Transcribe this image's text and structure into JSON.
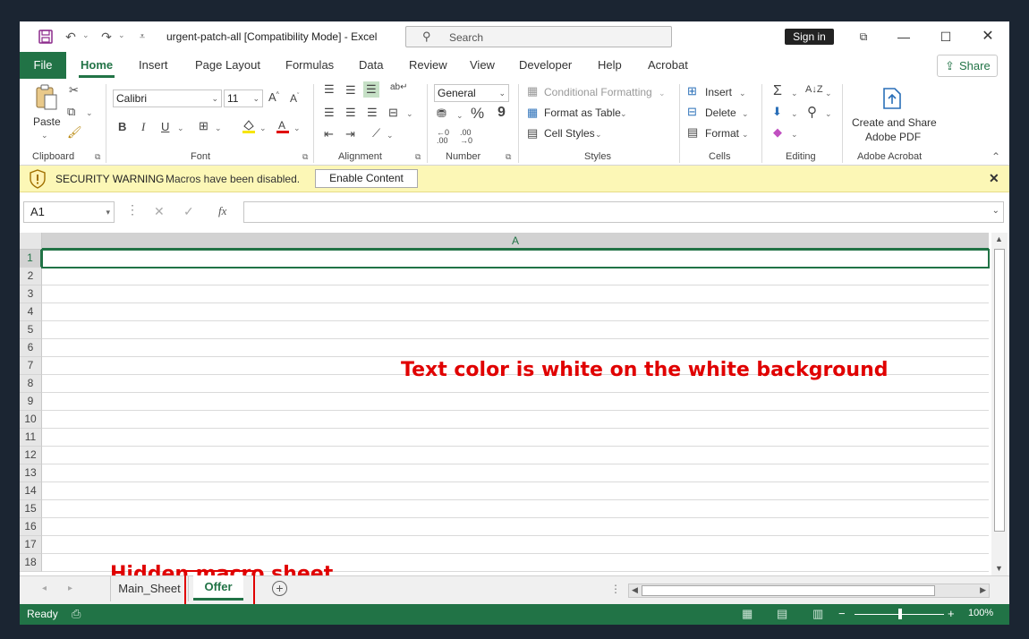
{
  "titlebar": {
    "title": "urgent-patch-all  [Compatibility Mode]  -  Excel",
    "search_placeholder": "Search",
    "signin_label": "Sign in",
    "icons": [
      "save-icon",
      "undo-icon",
      "redo-icon",
      "customize-quick-access-icon",
      "ribbon-display-icon",
      "minimize-icon",
      "maximize-icon",
      "close-icon"
    ]
  },
  "menu": {
    "file": "File",
    "tabs": [
      "Home",
      "Insert",
      "Page Layout",
      "Formulas",
      "Data",
      "Review",
      "View",
      "Developer",
      "Help",
      "Acrobat"
    ],
    "active_tab": "Home",
    "share_label": "Share"
  },
  "ribbon": {
    "clipboard": {
      "paste": "Paste",
      "label": "Clipboard"
    },
    "font": {
      "name": "Calibri",
      "size": "11",
      "bold": "B",
      "italic": "I",
      "underline": "U",
      "label": "Font"
    },
    "alignment": {
      "label": "Alignment"
    },
    "number": {
      "format": "General",
      "percent": "%",
      "comma": "9",
      "label": "Number"
    },
    "styles": {
      "conditional": "Conditional Formatting",
      "format_table": "Format as Table",
      "cell_styles": "Cell Styles",
      "label": "Styles"
    },
    "cells": {
      "insert": "Insert",
      "delete": "Delete",
      "format": "Format",
      "label": "Cells"
    },
    "editing": {
      "label": "Editing"
    },
    "acrobat": {
      "create_line1": "Create and Share",
      "create_line2": "Adobe PDF",
      "label": "Adobe Acrobat"
    }
  },
  "security": {
    "title": "SECURITY WARNING",
    "message": "Macros have been disabled.",
    "enable_label": "Enable Content"
  },
  "formula_bar": {
    "name_box": "A1",
    "fx": "fx",
    "value": ""
  },
  "grid": {
    "column_header": "A",
    "row_numbers": [
      "1",
      "2",
      "3",
      "4",
      "5",
      "6",
      "7",
      "8",
      "9",
      "10",
      "11",
      "12",
      "13",
      "14",
      "15",
      "16",
      "17",
      "18"
    ],
    "active_row": "1"
  },
  "annotations": {
    "white_text": "Text color is white on the white background",
    "hidden_sheet": "Hidden macro sheet"
  },
  "sheets": {
    "tabs": [
      "Main_Sheet",
      "Offer"
    ],
    "active": "Offer"
  },
  "status": {
    "ready": "Ready",
    "zoom": "100%"
  },
  "colors": {
    "excel_green": "#217346",
    "annotation_red": "#e00000",
    "security_bar": "#fcf7b6"
  }
}
